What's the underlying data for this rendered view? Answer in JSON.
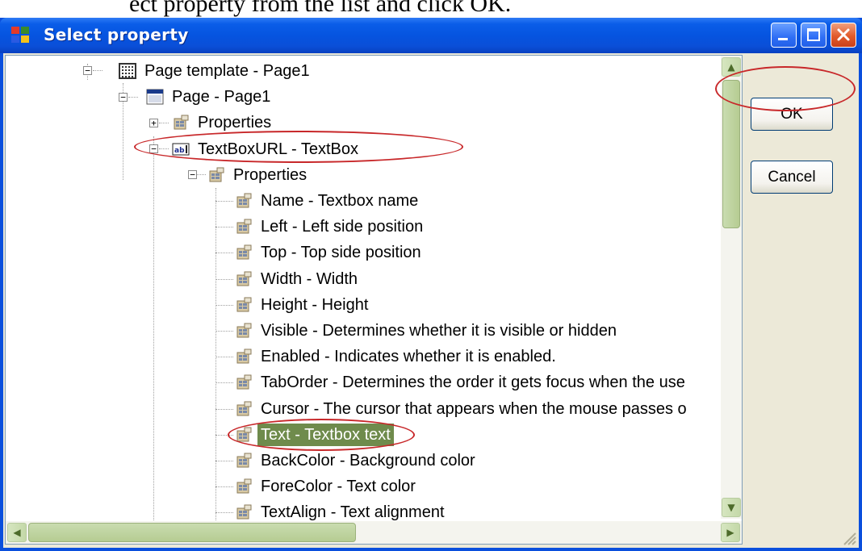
{
  "top_clip_text": "ect property from the list and click OK.",
  "window": {
    "title": "Select property",
    "buttons": {
      "minimize": "minimize",
      "maximize": "maximize",
      "close": "close"
    }
  },
  "tree": {
    "nodes": [
      {
        "label": "Page template - Page1",
        "icon": "page-template-icon"
      },
      {
        "label": "Page - Page1",
        "icon": "page-icon"
      },
      {
        "label": "Properties",
        "icon": "properties-icon"
      },
      {
        "label": "TextBoxURL - TextBox",
        "icon": "textbox-icon"
      },
      {
        "label": "Properties",
        "icon": "properties-icon"
      },
      {
        "label": "Name - Textbox name",
        "icon": "property-icon"
      },
      {
        "label": "Left - Left side position",
        "icon": "property-icon"
      },
      {
        "label": "Top - Top side position",
        "icon": "property-icon"
      },
      {
        "label": "Width - Width",
        "icon": "property-icon"
      },
      {
        "label": "Height - Height",
        "icon": "property-icon"
      },
      {
        "label": "Visible - Determines whether it is visible or hidden",
        "icon": "property-icon"
      },
      {
        "label": "Enabled - Indicates whether it is enabled.",
        "icon": "property-icon"
      },
      {
        "label": "TabOrder - Determines the order it gets focus when the use",
        "icon": "property-icon"
      },
      {
        "label": "Cursor - The cursor that appears when the mouse passes o",
        "icon": "property-icon"
      },
      {
        "label": "Text - Textbox text",
        "icon": "property-icon",
        "selected": true
      },
      {
        "label": "BackColor - Background color",
        "icon": "property-icon"
      },
      {
        "label": "ForeColor - Text color",
        "icon": "property-icon"
      },
      {
        "label": "TextAlign - Text alignment",
        "icon": "property-icon"
      }
    ]
  },
  "buttons": {
    "ok": "OK",
    "cancel": "Cancel"
  },
  "colors": {
    "titlebar": "#0a5de8",
    "selection": "#6f8b4c",
    "annotation": "#c8282a",
    "dialog": "#ece9d8"
  }
}
